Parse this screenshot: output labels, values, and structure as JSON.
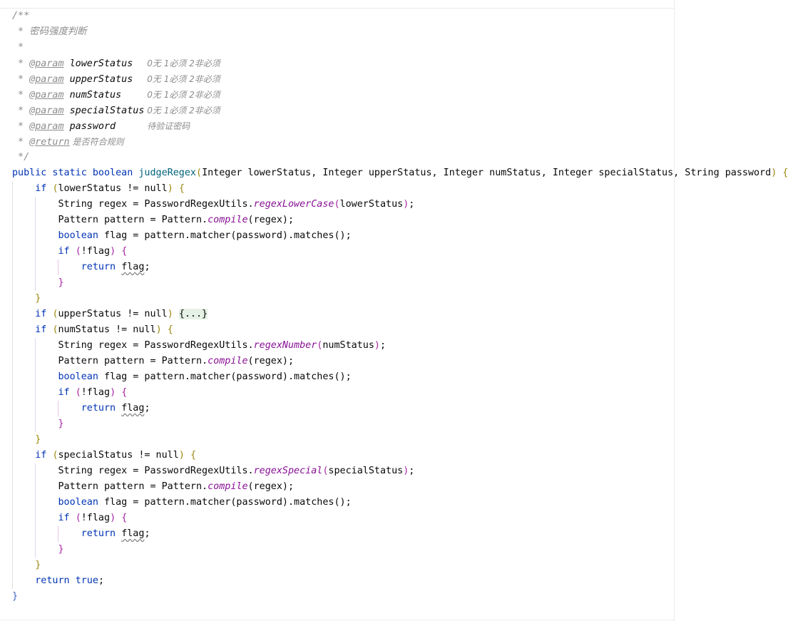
{
  "editor": {
    "language": "java",
    "colors": {
      "keyword": "#0033b3",
      "method": "#00627a",
      "static_call": "#871094",
      "comment": "#8c8c8c",
      "brace_level1": "#9e880d",
      "brace_level2": "#a626a4",
      "fold_background": "#e4f1e4"
    }
  },
  "javadoc": {
    "open": "/**",
    "summary": " * 密码强度判断",
    "blank": " *",
    "star": " * ",
    "params": [
      {
        "tag": "@param",
        "name": "lowerStatus  ",
        "desc": " 0无 1必须 2非必须"
      },
      {
        "tag": "@param",
        "name": "upperStatus  ",
        "desc": " 0无 1必须 2非必须"
      },
      {
        "tag": "@param",
        "name": "numStatus    ",
        "desc": " 0无 1必须 2非必须"
      },
      {
        "tag": "@param",
        "name": "specialStatus",
        "desc": " 0无 1必须 2非必须"
      },
      {
        "tag": "@param",
        "name": "password     ",
        "desc": " 待验证密码"
      }
    ],
    "return_tag": "@return",
    "return_desc": " 是否符合规则",
    "close": " */"
  },
  "method": {
    "modifiers": "public static boolean ",
    "name": "judgeRegex",
    "open_paren": "(",
    "params_text": "Integer lowerStatus, Integer upperStatus, Integer numStatus, Integer specialStatus, String password",
    "close_paren": ")",
    "open_brace": " {",
    "close_brace": "}"
  },
  "blocks": [
    {
      "condition": "lowerStatus != null",
      "folded": false,
      "regex_call": "regexLowerCase",
      "regex_arg": "lowerStatus"
    },
    {
      "condition": "upperStatus != null",
      "folded": true,
      "fold_text": "{...}"
    },
    {
      "condition": "numStatus != null",
      "folded": false,
      "regex_call": "regexNumber",
      "regex_arg": "numStatus"
    },
    {
      "condition": "specialStatus != null",
      "folded": false,
      "regex_call": "regexSpecial",
      "regex_arg": "specialStatus"
    }
  ],
  "tokens": {
    "if": "if",
    "space_open_paren": " (",
    "close_paren_brace": ") ",
    "open_brace": "{",
    "close_brace": "}",
    "string_decl": "String regex = PasswordRegexUtils.",
    "pattern_decl": "Pattern pattern = Pattern.",
    "compile": "compile",
    "compile_arg": "(regex);",
    "boolean": "boolean",
    "flag_decl": " flag = pattern.matcher(password).matches();",
    "neg_if_cond": "!flag",
    "return": "return",
    "flag": "flag",
    "semicolon": ";",
    "true": "true",
    "open_paren": "(",
    "close_paren": ")",
    "call_end": ");"
  }
}
